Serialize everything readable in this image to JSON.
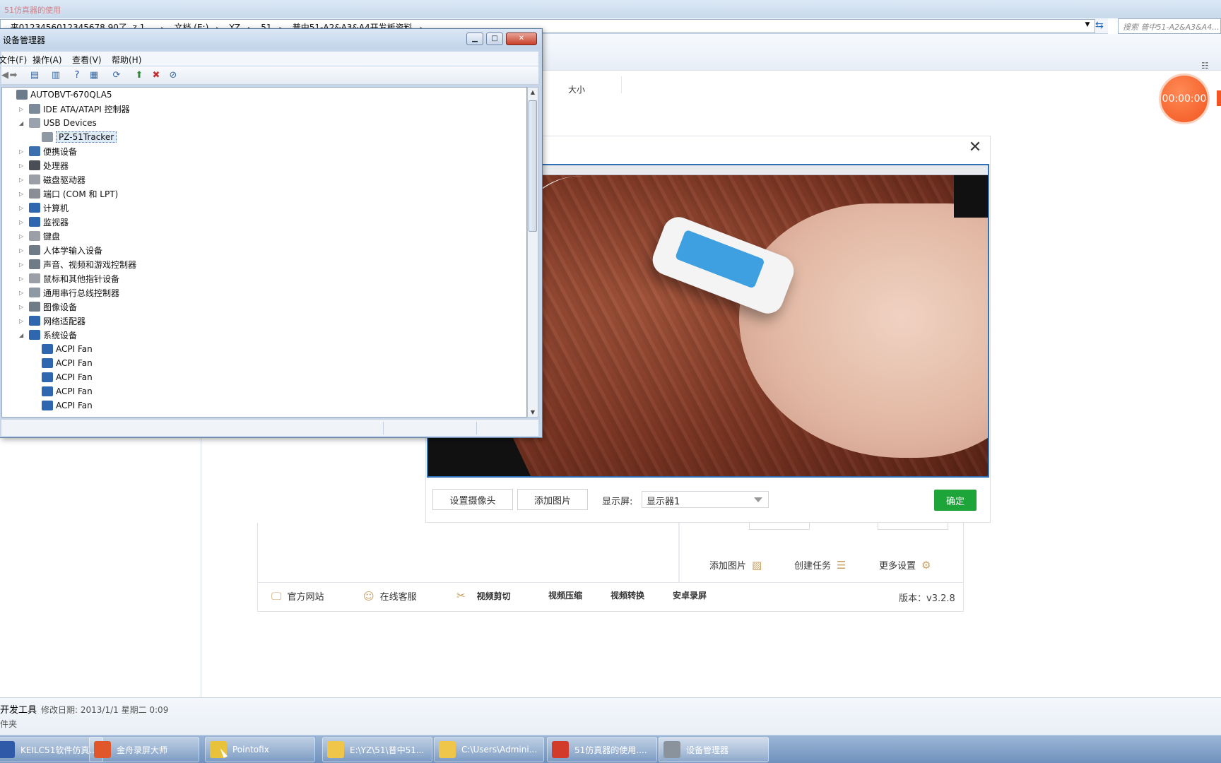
{
  "explorer": {
    "title": "51仿真器的使用",
    "address_segments": [
      ", 来0123456012345678 90了, z.1、",
      "文档 (E:)",
      "YZ",
      "51",
      "普中51-A2&A3&A4开发板资料"
    ],
    "search_placeholder": "搜索 普中51-A2&A3&A4...",
    "column_size": "大小",
    "details_name": "开发工具",
    "details_meta": "修改日期: 2013/1/1 星期二 0:09",
    "details_type": "件夹"
  },
  "recorder": {
    "timer": "00:00:00",
    "actions": [
      {
        "label": "添加图片",
        "icon": "image-icon"
      },
      {
        "label": "创建任务",
        "icon": "task-list-icon"
      },
      {
        "label": "更多设置",
        "icon": "settings-gear-icon"
      }
    ],
    "footer": [
      {
        "label": "官方网站",
        "icon": "monitor-icon"
      },
      {
        "label": "在线客服",
        "icon": "user-support-icon"
      },
      {
        "label": "视频剪切",
        "icon": "scissors-icon"
      },
      {
        "label": "视频压缩"
      },
      {
        "label": "视频转换"
      },
      {
        "label": "安卓录屏"
      }
    ],
    "version": "版本：v3.2.8"
  },
  "camera_dialog": {
    "set_camera_button": "设置摄像头",
    "add_image_button": "添加图片",
    "display_label": "显示屏:",
    "display_value": "显示器1",
    "ok_button": "确定",
    "close_icon": "close-x-icon"
  },
  "device_manager": {
    "title": "设备管理器",
    "menu": [
      "文件(F)",
      "操作(A)",
      "查看(V)",
      "帮助(H)"
    ],
    "tree": [
      {
        "label": "AUTOBVT-670QLA5",
        "level": 0,
        "expand": "",
        "icon_color": "#6b7b8c"
      },
      {
        "label": "IDE ATA/ATAPI 控制器",
        "level": 1,
        "expand": "▷",
        "icon_color": "#7c8b99"
      },
      {
        "label": "USB Devices",
        "level": 1,
        "expand": "◢",
        "icon_color": "#9aa3ad"
      },
      {
        "label": "PZ-51Tracker",
        "level": 2,
        "expand": "",
        "icon_color": "#8f99a3",
        "selected": true
      },
      {
        "label": "便携设备",
        "level": 1,
        "expand": "▷",
        "icon_color": "#3a6fb0"
      },
      {
        "label": "处理器",
        "level": 1,
        "expand": "▷",
        "icon_color": "#4a4f55"
      },
      {
        "label": "磁盘驱动器",
        "level": 1,
        "expand": "▷",
        "icon_color": "#9aa0a6"
      },
      {
        "label": "端口 (COM 和 LPT)",
        "level": 1,
        "expand": "▷",
        "icon_color": "#8a8f95"
      },
      {
        "label": "计算机",
        "level": 1,
        "expand": "▷",
        "icon_color": "#2f66b0"
      },
      {
        "label": "监视器",
        "level": 1,
        "expand": "▷",
        "icon_color": "#2f66b0"
      },
      {
        "label": "键盘",
        "level": 1,
        "expand": "▷",
        "icon_color": "#9aa0a6"
      },
      {
        "label": "人体学输入设备",
        "level": 1,
        "expand": "▷",
        "icon_color": "#6f7c88"
      },
      {
        "label": "声音、视频和游戏控制器",
        "level": 1,
        "expand": "▷",
        "icon_color": "#6f7c88"
      },
      {
        "label": "鼠标和其他指针设备",
        "level": 1,
        "expand": "▷",
        "icon_color": "#9aa0a6"
      },
      {
        "label": "通用串行总线控制器",
        "level": 1,
        "expand": "▷",
        "icon_color": "#8f99a3"
      },
      {
        "label": "图像设备",
        "level": 1,
        "expand": "▷",
        "icon_color": "#6f7c88"
      },
      {
        "label": "网络适配器",
        "level": 1,
        "expand": "▷",
        "icon_color": "#2f66b0"
      },
      {
        "label": "系统设备",
        "level": 1,
        "expand": "◢",
        "icon_color": "#2f66b0"
      },
      {
        "label": "ACPI Fan",
        "level": 2,
        "expand": "",
        "icon_color": "#2f66b0"
      },
      {
        "label": "ACPI Fan",
        "level": 2,
        "expand": "",
        "icon_color": "#2f66b0"
      },
      {
        "label": "ACPI Fan",
        "level": 2,
        "expand": "",
        "icon_color": "#2f66b0"
      },
      {
        "label": "ACPI Fan",
        "level": 2,
        "expand": "",
        "icon_color": "#2f66b0"
      },
      {
        "label": "ACPI Fan",
        "level": 2,
        "expand": "",
        "icon_color": "#2f66b0"
      }
    ]
  },
  "taskbar": [
    {
      "label": "KEILC51软件仿真...",
      "icon_color": "#2e5aa8"
    },
    {
      "label": "金舟录屏大师",
      "icon_color": "#e0572b"
    },
    {
      "label": "Pointofix",
      "icon_color": "#e8c23a"
    },
    {
      "label": "E:\\YZ\\51\\普中51...",
      "icon_color": "#f0c64a"
    },
    {
      "label": "C:\\Users\\Admini...",
      "icon_color": "#f0c64a"
    },
    {
      "label": "51仿真器的使用....",
      "icon_color": "#d23a2a"
    },
    {
      "label": "设备管理器",
      "icon_color": "#8a939c",
      "active": true
    }
  ]
}
